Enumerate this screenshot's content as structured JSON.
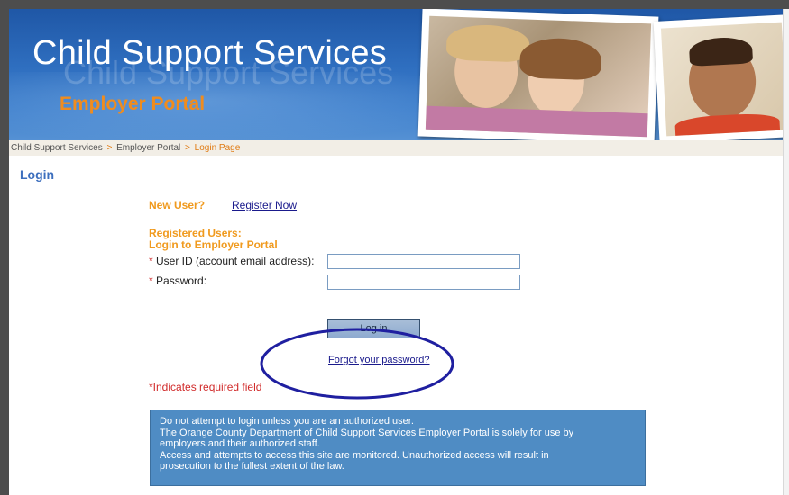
{
  "banner": {
    "title": "Child Support Services",
    "ghost_title": "Child Support Services",
    "subtitle": "Employer Portal"
  },
  "breadcrumb": {
    "item1": "Child Support Services",
    "item2": "Employer Portal",
    "current": "Login Page",
    "separator": ">"
  },
  "page": {
    "heading": "Login"
  },
  "new_user": {
    "label": "New User?",
    "register_link": "Register Now"
  },
  "registered": {
    "line1": "Registered Users:",
    "line2": "Login to Employer Portal"
  },
  "form": {
    "required_marker": "*",
    "user_id_label": "User ID (account email address):",
    "password_label": "Password:",
    "user_id_value": "",
    "password_value": "",
    "login_button": "Log in",
    "forgot_link": "Forgot your password?",
    "required_note": "*Indicates required field"
  },
  "notice": {
    "lines": [
      "Do not attempt to login unless you are an authorized user.",
      "The Orange County Department of Child Support Services Employer Portal is solely for use by",
      "employers and their authorized staff.",
      "Access and attempts to access this site are monitored. Unauthorized access will result in",
      "prosecution to the fullest extent of the law."
    ]
  },
  "colors": {
    "banner_blue": "#2f6fc0",
    "accent_orange": "#f09a1e",
    "heading_blue": "#3d6fbe",
    "required_red": "#d12b2b",
    "link_navy": "#1a1a8c",
    "notice_blue": "#4f8cc4",
    "annotation_ellipse": "#1f1fa0"
  }
}
